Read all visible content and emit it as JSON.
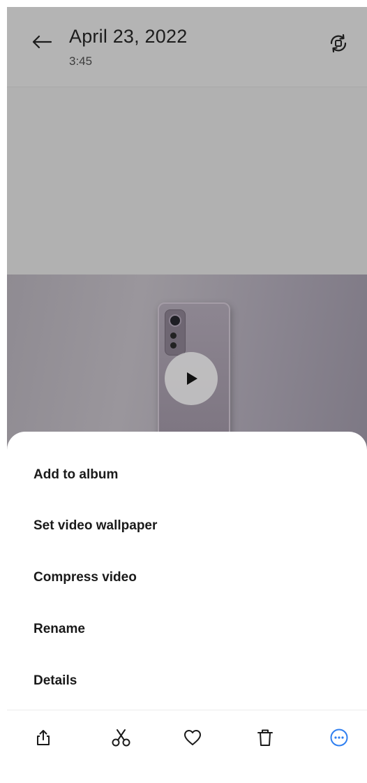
{
  "header": {
    "title": "April 23, 2022",
    "subtitle": "3:45"
  },
  "menu": {
    "items": [
      {
        "label": "Add to album"
      },
      {
        "label": "Set video wallpaper"
      },
      {
        "label": "Compress video"
      },
      {
        "label": "Rename"
      },
      {
        "label": "Details"
      }
    ]
  },
  "toolbar": {
    "icons": [
      "share-icon",
      "scissors-icon",
      "heart-icon",
      "trash-icon",
      "more-icon"
    ],
    "accent_color": "#2f7ff0"
  },
  "colors": {
    "overlay": "#b1b1b1",
    "sheet": "#ffffff"
  }
}
